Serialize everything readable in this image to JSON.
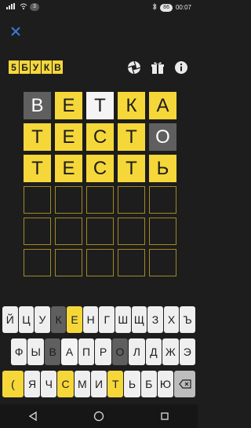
{
  "status": {
    "badge": "3",
    "battery": "86",
    "time": "00:07"
  },
  "logo": [
    "5",
    "Б",
    "У",
    "К",
    "В"
  ],
  "board": [
    [
      {
        "l": "В",
        "s": "absent"
      },
      {
        "l": "Е",
        "s": "correct"
      },
      {
        "l": "Т",
        "s": "present"
      },
      {
        "l": "К",
        "s": "correct"
      },
      {
        "l": "А",
        "s": "correct"
      }
    ],
    [
      {
        "l": "Т",
        "s": "correct"
      },
      {
        "l": "Е",
        "s": "correct"
      },
      {
        "l": "С",
        "s": "correct"
      },
      {
        "l": "Т",
        "s": "correct"
      },
      {
        "l": "О",
        "s": "absent"
      }
    ],
    [
      {
        "l": "Т",
        "s": "correct"
      },
      {
        "l": "Е",
        "s": "correct"
      },
      {
        "l": "С",
        "s": "correct"
      },
      {
        "l": "Т",
        "s": "correct"
      },
      {
        "l": "Ь",
        "s": "correct"
      }
    ],
    [
      {
        "l": "",
        "s": "empty"
      },
      {
        "l": "",
        "s": "empty"
      },
      {
        "l": "",
        "s": "empty"
      },
      {
        "l": "",
        "s": "empty"
      },
      {
        "l": "",
        "s": "empty"
      }
    ],
    [
      {
        "l": "",
        "s": "empty"
      },
      {
        "l": "",
        "s": "empty"
      },
      {
        "l": "",
        "s": "empty"
      },
      {
        "l": "",
        "s": "empty"
      },
      {
        "l": "",
        "s": "empty"
      }
    ],
    [
      {
        "l": "",
        "s": "empty"
      },
      {
        "l": "",
        "s": "empty"
      },
      {
        "l": "",
        "s": "empty"
      },
      {
        "l": "",
        "s": "empty"
      },
      {
        "l": "",
        "s": "empty"
      }
    ]
  ],
  "keyboard": {
    "row1": [
      {
        "l": "Й",
        "s": ""
      },
      {
        "l": "Ц",
        "s": ""
      },
      {
        "l": "У",
        "s": ""
      },
      {
        "l": "К",
        "s": "absent"
      },
      {
        "l": "Е",
        "s": "correct"
      },
      {
        "l": "Н",
        "s": ""
      },
      {
        "l": "Г",
        "s": ""
      },
      {
        "l": "Ш",
        "s": ""
      },
      {
        "l": "Щ",
        "s": ""
      },
      {
        "l": "З",
        "s": ""
      },
      {
        "l": "Х",
        "s": ""
      },
      {
        "l": "Ъ",
        "s": ""
      }
    ],
    "row2": [
      {
        "l": "Ф",
        "s": ""
      },
      {
        "l": "Ы",
        "s": ""
      },
      {
        "l": "В",
        "s": "absent"
      },
      {
        "l": "А",
        "s": "present"
      },
      {
        "l": "П",
        "s": ""
      },
      {
        "l": "Р",
        "s": ""
      },
      {
        "l": "О",
        "s": "absent"
      },
      {
        "l": "Л",
        "s": ""
      },
      {
        "l": "Д",
        "s": ""
      },
      {
        "l": "Ж",
        "s": ""
      },
      {
        "l": "Э",
        "s": ""
      }
    ],
    "row3": [
      {
        "l": "Я",
        "s": ""
      },
      {
        "l": "Ч",
        "s": ""
      },
      {
        "l": "С",
        "s": "correct"
      },
      {
        "l": "М",
        "s": ""
      },
      {
        "l": "И",
        "s": ""
      },
      {
        "l": "Т",
        "s": "correct"
      },
      {
        "l": "Ь",
        "s": ""
      },
      {
        "l": "Б",
        "s": ""
      },
      {
        "l": "Ю",
        "s": ""
      }
    ],
    "enter_label": "(",
    "backspace_icon": "backspace-icon"
  },
  "colors": {
    "bg": "#1d1d1d",
    "yellow": "#f5d73a",
    "gray": "#5f5f5f",
    "light": "#f4f4f4",
    "close": "#3a7bd5"
  }
}
